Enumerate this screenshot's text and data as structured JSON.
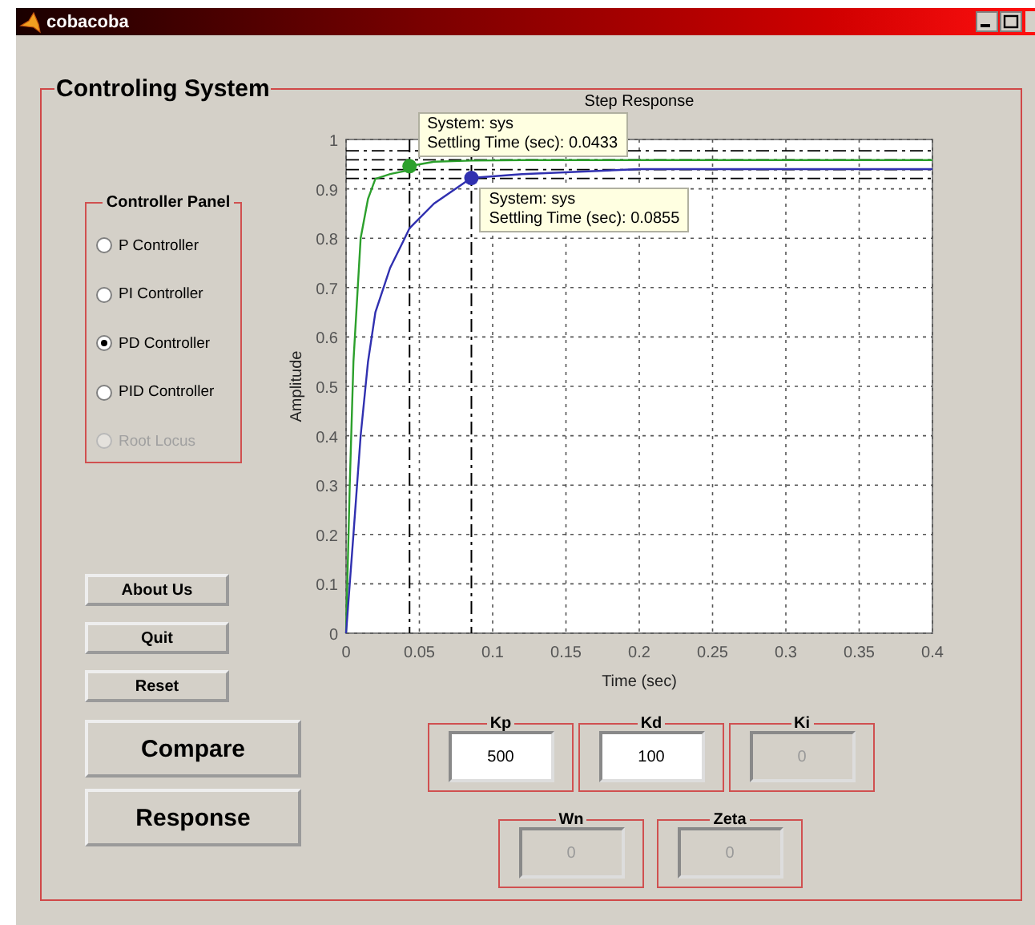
{
  "window": {
    "title": "cobacoba"
  },
  "panel": {
    "title": "Controling System"
  },
  "controller_panel": {
    "title": "Controller Panel",
    "options": [
      {
        "label": "P Controller",
        "selected": false,
        "disabled": false
      },
      {
        "label": "PI Controller",
        "selected": false,
        "disabled": false
      },
      {
        "label": "PD Controller",
        "selected": true,
        "disabled": false
      },
      {
        "label": "PID Controller",
        "selected": false,
        "disabled": false
      },
      {
        "label": "Root Locus",
        "selected": false,
        "disabled": true
      }
    ]
  },
  "buttons": [
    {
      "label": "About Us",
      "kind": "small"
    },
    {
      "label": "Quit",
      "kind": "small"
    },
    {
      "label": "Reset",
      "kind": "small"
    },
    {
      "label": "Compare",
      "kind": "large"
    },
    {
      "label": "Response",
      "kind": "large"
    }
  ],
  "plot": {
    "chart_data": {
      "type": "line",
      "title": "Step Response",
      "xlabel": "Time (sec)",
      "ylabel": "Amplitude",
      "x": [
        0,
        0.0025,
        0.005,
        0.01,
        0.015,
        0.02,
        0.03,
        0.04,
        0.0433,
        0.06,
        0.0855,
        0.12,
        0.2,
        0.3,
        0.4
      ],
      "series": [
        {
          "color": "#2ca02c",
          "values": [
            0,
            0.3,
            0.55,
            0.8,
            0.88,
            0.92,
            0.93,
            0.936,
            0.946,
            0.955,
            0.957,
            0.958,
            0.958,
            0.958,
            0.958
          ]
        },
        {
          "color": "#3030b0",
          "values": [
            0,
            0.1,
            0.2,
            0.4,
            0.55,
            0.65,
            0.74,
            0.8,
            0.82,
            0.87,
            0.922,
            0.93,
            0.94,
            0.94,
            0.94
          ]
        }
      ],
      "xlim": [
        0,
        0.4
      ],
      "ylim": [
        0,
        1
      ],
      "xticks": [
        0,
        0.05,
        0.1,
        0.15,
        0.2,
        0.25,
        0.3,
        0.35,
        0.4
      ],
      "yticks": [
        0,
        0.1,
        0.2,
        0.3,
        0.4,
        0.5,
        0.6,
        0.7,
        0.8,
        0.9,
        1
      ],
      "grid": true,
      "annotations": [
        {
          "text": "System: sys\nSettling Time (sec): 0.0433"
        },
        {
          "text": "System: sys\nSettling Time (sec): 0.0855"
        }
      ]
    }
  },
  "parameter_rows": [
    [
      {
        "label": "Kp",
        "value": "500",
        "disabled": false
      },
      {
        "label": "Kd",
        "value": "100",
        "disabled": false
      },
      {
        "label": "Ki",
        "value": "0",
        "disabled": true
      }
    ],
    [
      {
        "label": "Wn",
        "value": "0",
        "disabled": true
      },
      {
        "label": "Zeta",
        "value": "0",
        "disabled": true
      }
    ]
  ]
}
